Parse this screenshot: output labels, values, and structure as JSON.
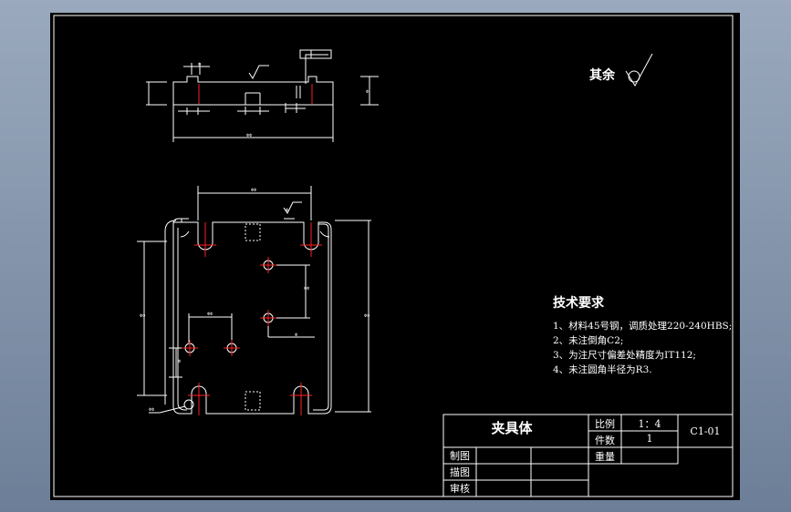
{
  "drawing": {
    "title": "夹具体",
    "surface_finish_note": "其余",
    "tech_requirements": {
      "heading": "技术要求",
      "items": [
        "1、材料45号钢，调质处理220-240HBS;",
        "2、未注倒角C2;",
        "3、为注尺寸偏差处精度为IT112;",
        "4、未注圆角半径为R3."
      ]
    },
    "title_block": {
      "scale_label": "比例",
      "scale_value": "1：4",
      "quantity_label": "件数",
      "quantity_value": "1",
      "drawing_number": "C1-01",
      "weight_label": "重量",
      "drawn_label": "制图",
      "traced_label": "描图",
      "checked_label": "审核"
    }
  },
  "colors": {
    "background": "#000000",
    "lines": "#ffffff",
    "centerlines": "#ff2020",
    "frame_gradient_top": "#9aa9bd",
    "frame_gradient_bottom": "#6d7f98"
  }
}
